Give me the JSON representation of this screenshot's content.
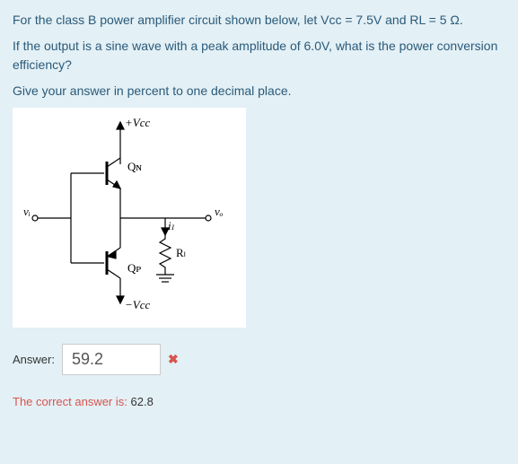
{
  "question": {
    "line1": "For the class B power amplifier circuit shown below, let Vcc = 7.5V and RL = 5 Ω.",
    "line2": "If the output is a sine wave with a peak amplitude of 6.0V, what is the power conversion efficiency?",
    "line3": "Give your answer in percent to one decimal place."
  },
  "circuit": {
    "vcc_top": "+Vcc",
    "vcc_bot": "−Vcc",
    "qn": "Qɴ",
    "qp": "Qᴘ",
    "vi": "vᵢ",
    "vo": "vₒ",
    "il": "iₗ",
    "rl": "Rₗ"
  },
  "answer": {
    "label": "Answer:",
    "value": "59.2"
  },
  "correct": {
    "prefix": "The correct answer is: ",
    "value": "62.8"
  }
}
